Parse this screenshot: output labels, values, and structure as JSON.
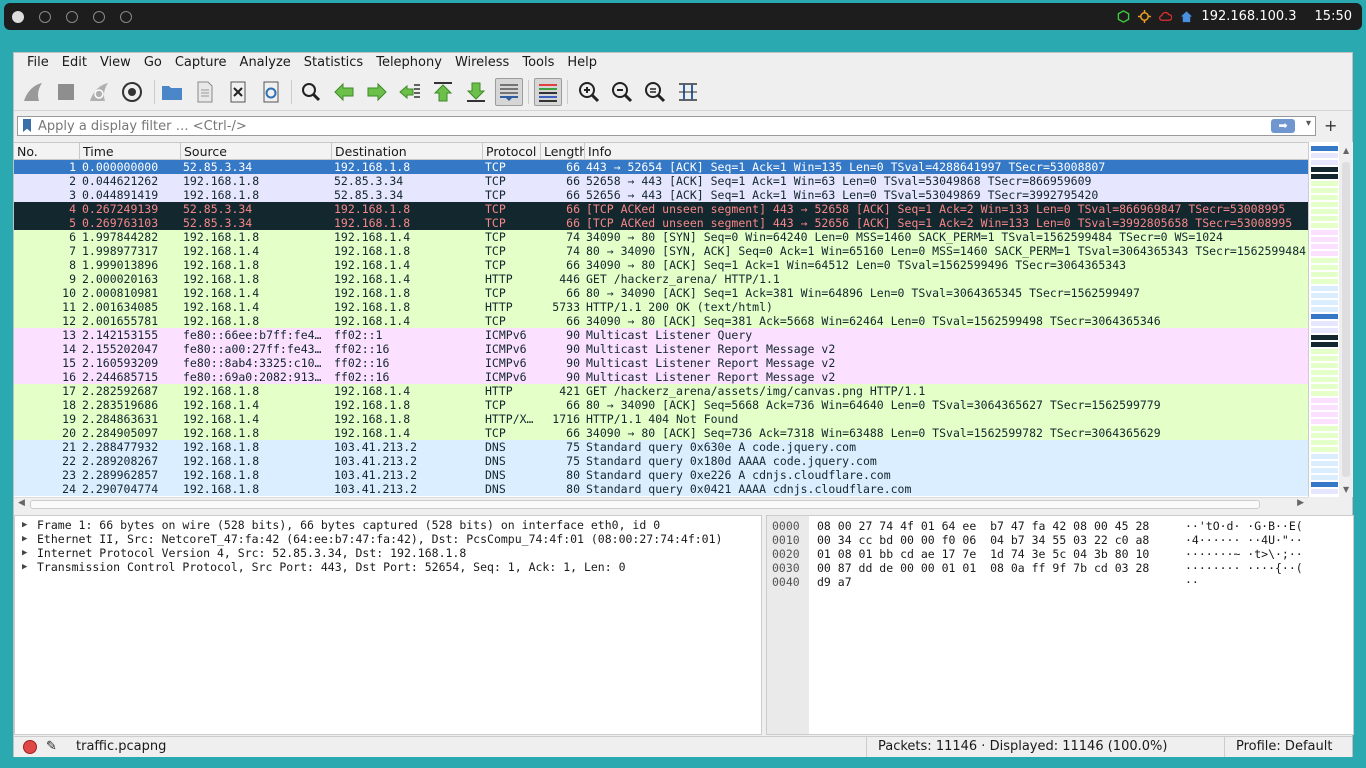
{
  "topbar": {
    "ip": "192.168.100.3",
    "time": "15:50"
  },
  "menu": [
    "File",
    "Edit",
    "View",
    "Go",
    "Capture",
    "Analyze",
    "Statistics",
    "Telephony",
    "Wireless",
    "Tools",
    "Help"
  ],
  "filter": {
    "placeholder": "Apply a display filter … <Ctrl-/>"
  },
  "columns": [
    "No.",
    "Time",
    "Source",
    "Destination",
    "Protocol",
    "Length",
    "Info"
  ],
  "packets": [
    {
      "no": "1",
      "time": "0.000000000",
      "src": "52.85.3.34",
      "dst": "192.168.1.8",
      "proto": "TCP",
      "len": "66",
      "info": "443 → 52654 [ACK] Seq=1 Ack=1 Win=135 Len=0 TSval=4288641997 TSecr=53008807",
      "bg": "#3478c6",
      "fg": "#ffffff"
    },
    {
      "no": "2",
      "time": "0.044621262",
      "src": "192.168.1.8",
      "dst": "52.85.3.34",
      "proto": "TCP",
      "len": "66",
      "info": "52658 → 443 [ACK] Seq=1 Ack=1 Win=63 Len=0 TSval=53049868 TSecr=866959609",
      "bg": "#e7e6ff",
      "fg": "#12272e"
    },
    {
      "no": "3",
      "time": "0.044891419",
      "src": "192.168.1.8",
      "dst": "52.85.3.34",
      "proto": "TCP",
      "len": "66",
      "info": "52656 → 443 [ACK] Seq=1 Ack=1 Win=63 Len=0 TSval=53049869 TSecr=3992795420",
      "bg": "#e7e6ff",
      "fg": "#12272e"
    },
    {
      "no": "4",
      "time": "0.267249139",
      "src": "52.85.3.34",
      "dst": "192.168.1.8",
      "proto": "TCP",
      "len": "66",
      "info": "[TCP ACKed unseen segment] 443 → 52658 [ACK] Seq=1 Ack=2 Win=133 Len=0 TSval=866969847 TSecr=53008995",
      "bg": "#12272e",
      "fg": "#f78787"
    },
    {
      "no": "5",
      "time": "0.269763103",
      "src": "52.85.3.34",
      "dst": "192.168.1.8",
      "proto": "TCP",
      "len": "66",
      "info": "[TCP ACKed unseen segment] 443 → 52656 [ACK] Seq=1 Ack=2 Win=133 Len=0 TSval=3992805658 TSecr=53008995",
      "bg": "#12272e",
      "fg": "#f78787"
    },
    {
      "no": "6",
      "time": "1.997844282",
      "src": "192.168.1.8",
      "dst": "192.168.1.4",
      "proto": "TCP",
      "len": "74",
      "info": "34090 → 80 [SYN] Seq=0 Win=64240 Len=0 MSS=1460 SACK_PERM=1 TSval=1562599484 TSecr=0 WS=1024",
      "bg": "#e4ffc7",
      "fg": "#12272e"
    },
    {
      "no": "7",
      "time": "1.998977317",
      "src": "192.168.1.4",
      "dst": "192.168.1.8",
      "proto": "TCP",
      "len": "74",
      "info": "80 → 34090 [SYN, ACK] Seq=0 Ack=1 Win=65160 Len=0 MSS=1460 SACK_PERM=1 TSval=3064365343 TSecr=1562599484",
      "bg": "#e4ffc7",
      "fg": "#12272e"
    },
    {
      "no": "8",
      "time": "1.999013896",
      "src": "192.168.1.8",
      "dst": "192.168.1.4",
      "proto": "TCP",
      "len": "66",
      "info": "34090 → 80 [ACK] Seq=1 Ack=1 Win=64512 Len=0 TSval=1562599496 TSecr=3064365343",
      "bg": "#e4ffc7",
      "fg": "#12272e"
    },
    {
      "no": "9",
      "time": "2.000020163",
      "src": "192.168.1.8",
      "dst": "192.168.1.4",
      "proto": "HTTP",
      "len": "446",
      "info": "GET /hackerz_arena/ HTTP/1.1",
      "bg": "#e4ffc7",
      "fg": "#12272e"
    },
    {
      "no": "10",
      "time": "2.000810981",
      "src": "192.168.1.4",
      "dst": "192.168.1.8",
      "proto": "TCP",
      "len": "66",
      "info": "80 → 34090 [ACK] Seq=1 Ack=381 Win=64896 Len=0 TSval=3064365345 TSecr=1562599497",
      "bg": "#e4ffc7",
      "fg": "#12272e"
    },
    {
      "no": "11",
      "time": "2.001634085",
      "src": "192.168.1.4",
      "dst": "192.168.1.8",
      "proto": "HTTP",
      "len": "5733",
      "info": "HTTP/1.1 200 OK  (text/html)",
      "bg": "#e4ffc7",
      "fg": "#12272e"
    },
    {
      "no": "12",
      "time": "2.001655781",
      "src": "192.168.1.8",
      "dst": "192.168.1.4",
      "proto": "TCP",
      "len": "66",
      "info": "34090 → 80 [ACK] Seq=381 Ack=5668 Win=62464 Len=0 TSval=1562599498 TSecr=3064365346",
      "bg": "#e4ffc7",
      "fg": "#12272e"
    },
    {
      "no": "13",
      "time": "2.142153155",
      "src": "fe80::66ee:b7ff:fe4…",
      "dst": "ff02::1",
      "proto": "ICMPv6",
      "len": "90",
      "info": "Multicast Listener Query",
      "bg": "#fce0ff",
      "fg": "#12272e"
    },
    {
      "no": "14",
      "time": "2.155202047",
      "src": "fe80::a00:27ff:fe43…",
      "dst": "ff02::16",
      "proto": "ICMPv6",
      "len": "90",
      "info": "Multicast Listener Report Message v2",
      "bg": "#fce0ff",
      "fg": "#12272e"
    },
    {
      "no": "15",
      "time": "2.160593209",
      "src": "fe80::8ab4:3325:c10…",
      "dst": "ff02::16",
      "proto": "ICMPv6",
      "len": "90",
      "info": "Multicast Listener Report Message v2",
      "bg": "#fce0ff",
      "fg": "#12272e"
    },
    {
      "no": "16",
      "time": "2.244685715",
      "src": "fe80::69a0:2082:913…",
      "dst": "ff02::16",
      "proto": "ICMPv6",
      "len": "90",
      "info": "Multicast Listener Report Message v2",
      "bg": "#fce0ff",
      "fg": "#12272e"
    },
    {
      "no": "17",
      "time": "2.282592687",
      "src": "192.168.1.8",
      "dst": "192.168.1.4",
      "proto": "HTTP",
      "len": "421",
      "info": "GET /hackerz_arena/assets/img/canvas.png HTTP/1.1",
      "bg": "#e4ffc7",
      "fg": "#12272e"
    },
    {
      "no": "18",
      "time": "2.283519686",
      "src": "192.168.1.4",
      "dst": "192.168.1.8",
      "proto": "TCP",
      "len": "66",
      "info": "80 → 34090 [ACK] Seq=5668 Ack=736 Win=64640 Len=0 TSval=3064365627 TSecr=1562599779",
      "bg": "#e4ffc7",
      "fg": "#12272e"
    },
    {
      "no": "19",
      "time": "2.284863631",
      "src": "192.168.1.4",
      "dst": "192.168.1.8",
      "proto": "HTTP/X…",
      "len": "1716",
      "info": "HTTP/1.1 404 Not Found",
      "bg": "#e4ffc7",
      "fg": "#12272e"
    },
    {
      "no": "20",
      "time": "2.284905097",
      "src": "192.168.1.8",
      "dst": "192.168.1.4",
      "proto": "TCP",
      "len": "66",
      "info": "34090 → 80 [ACK] Seq=736 Ack=7318 Win=63488 Len=0 TSval=1562599782 TSecr=3064365629",
      "bg": "#e4ffc7",
      "fg": "#12272e"
    },
    {
      "no": "21",
      "time": "2.288477932",
      "src": "192.168.1.8",
      "dst": "103.41.213.2",
      "proto": "DNS",
      "len": "75",
      "info": "Standard query 0x630e A code.jquery.com",
      "bg": "#daeeff",
      "fg": "#12272e"
    },
    {
      "no": "22",
      "time": "2.289208267",
      "src": "192.168.1.8",
      "dst": "103.41.213.2",
      "proto": "DNS",
      "len": "75",
      "info": "Standard query 0x180d AAAA code.jquery.com",
      "bg": "#daeeff",
      "fg": "#12272e"
    },
    {
      "no": "23",
      "time": "2.289962857",
      "src": "192.168.1.8",
      "dst": "103.41.213.2",
      "proto": "DNS",
      "len": "80",
      "info": "Standard query 0xe226 A cdnjs.cloudflare.com",
      "bg": "#daeeff",
      "fg": "#12272e"
    },
    {
      "no": "24",
      "time": "2.290704774",
      "src": "192.168.1.8",
      "dst": "103.41.213.2",
      "proto": "DNS",
      "len": "80",
      "info": "Standard query 0x0421 AAAA cdnjs.cloudflare.com",
      "bg": "#daeeff",
      "fg": "#12272e"
    }
  ],
  "details": [
    "Frame 1: 66 bytes on wire (528 bits), 66 bytes captured (528 bits) on interface eth0, id 0",
    "Ethernet II, Src: NetcoreT_47:fa:42 (64:ee:b7:47:fa:42), Dst: PcsCompu_74:4f:01 (08:00:27:74:4f:01)",
    "Internet Protocol Version 4, Src: 52.85.3.34, Dst: 192.168.1.8",
    "Transmission Control Protocol, Src Port: 443, Dst Port: 52654, Seq: 1, Ack: 1, Len: 0"
  ],
  "bytes": [
    {
      "off": "0000",
      "hex": "08 00 27 74 4f 01 64 ee  b7 47 fa 42 08 00 45 28",
      "ascii": "··'tO·d· ·G·B··E("
    },
    {
      "off": "0010",
      "hex": "00 34 cc bd 00 00 f0 06  04 b7 34 55 03 22 c0 a8",
      "ascii": "·4······ ··4U·\"··"
    },
    {
      "off": "0020",
      "hex": "01 08 01 bb cd ae 17 7e  1d 74 3e 5c 04 3b 80 10",
      "ascii": "·······~ ·t>\\·;··"
    },
    {
      "off": "0030",
      "hex": "00 87 dd de 00 00 01 01  08 0a ff 9f 7b cd 03 28",
      "ascii": "········ ····{··("
    },
    {
      "off": "0040",
      "hex": "d9 a7",
      "ascii": "··"
    }
  ],
  "status": {
    "file": "traffic.pcapng",
    "packets": "Packets: 11146 · Displayed: 11146 (100.0%)",
    "profile": "Profile: Default"
  }
}
